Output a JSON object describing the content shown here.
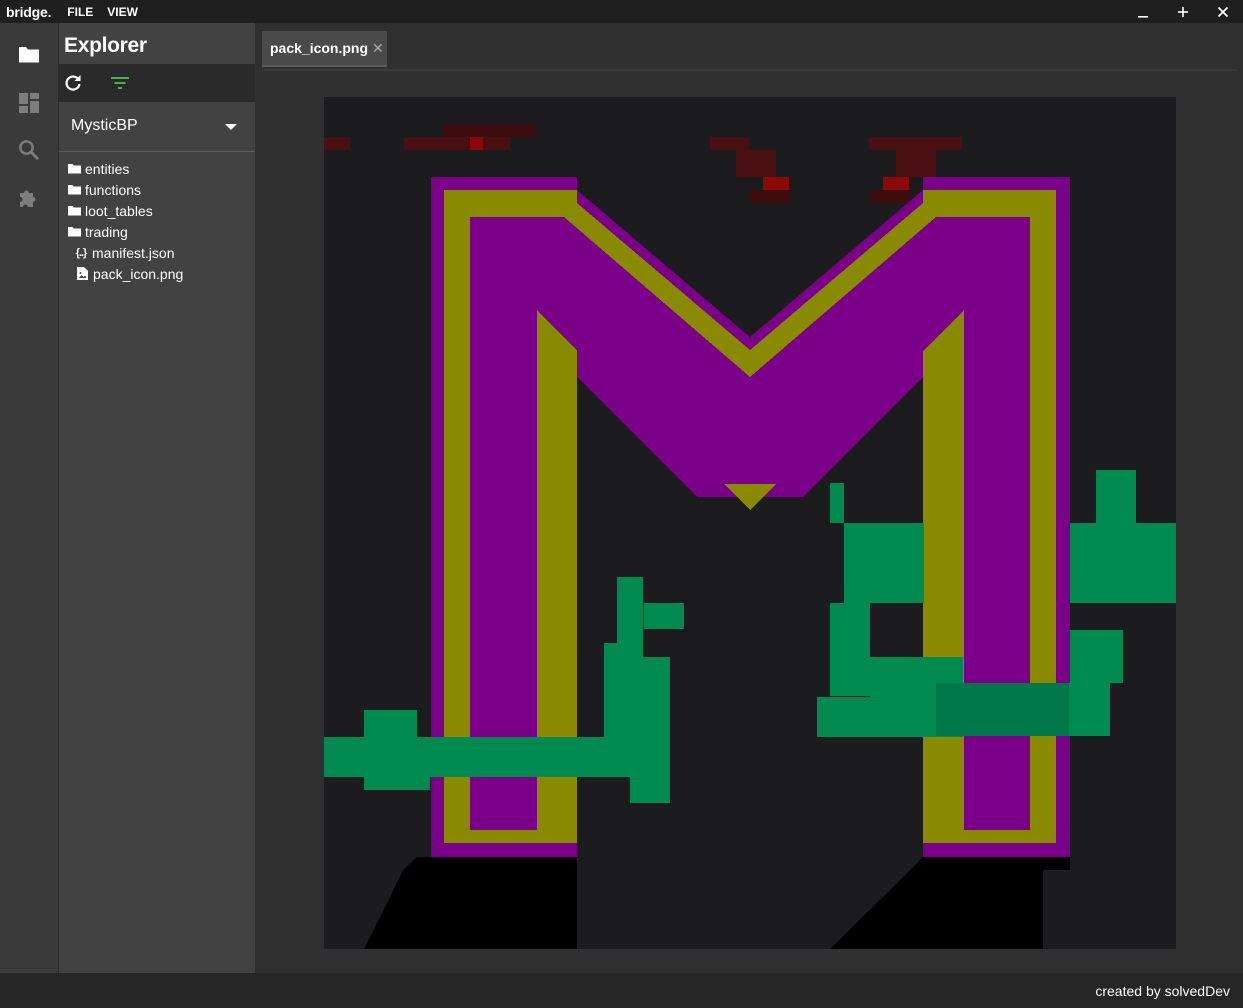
{
  "app": {
    "brand": "bridge."
  },
  "menu": [
    "FILE",
    "VIEW"
  ],
  "window_controls": {
    "minimize": "_",
    "maximize": "+",
    "close": "✕"
  },
  "activity_bar": [
    "folder-icon",
    "dashboard-icon",
    "search-icon",
    "extension-icon"
  ],
  "explorer": {
    "title": "Explorer",
    "project": "MysticBP",
    "tree": [
      {
        "type": "folder",
        "label": "entities"
      },
      {
        "type": "folder",
        "label": "functions"
      },
      {
        "type": "folder",
        "label": "loot_tables"
      },
      {
        "type": "folder",
        "label": "trading"
      },
      {
        "type": "json",
        "label": "manifest.json"
      },
      {
        "type": "image",
        "label": "pack_icon.png"
      }
    ]
  },
  "tabs": [
    {
      "label": "pack_icon.png",
      "close": "✕"
    }
  ],
  "footer": {
    "credit": "created by solvedDev"
  },
  "colors": {
    "accent_filter": "#4caf50",
    "purple": "#7a008a",
    "olive": "#8a8a00",
    "vine": "#008a4f",
    "blood": "#7a1010"
  }
}
